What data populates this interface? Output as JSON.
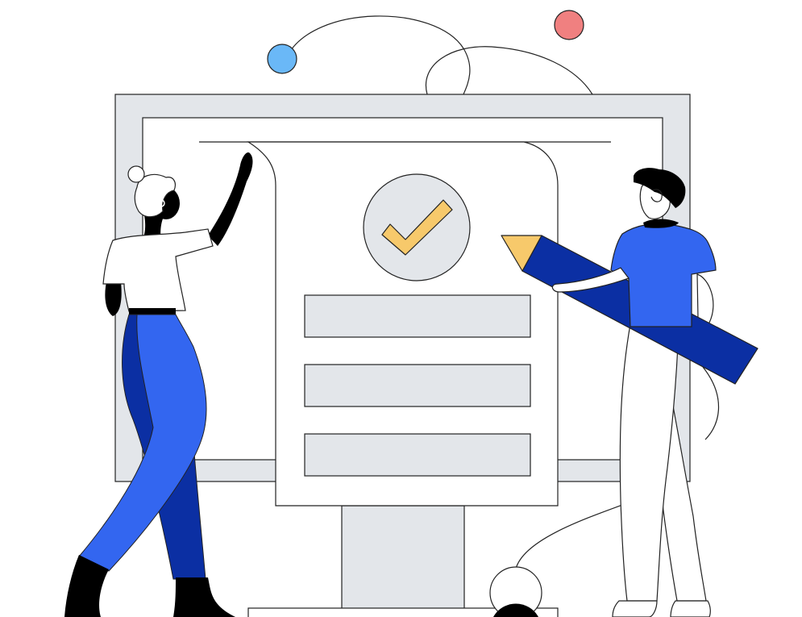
{
  "scene": {
    "subject": "illustration",
    "colors": {
      "outline": "#222222",
      "panel_gray": "#e3e6ea",
      "white": "#ffffff",
      "check_yellow": "#f7c96b",
      "accent_blue": "#3366f0",
      "deep_blue": "#0b2fa3",
      "dot_blue": "#6ab8f7",
      "dot_red": "#f08080",
      "skin_dark": "#000000"
    },
    "document": {
      "check_icon": "checkmark-icon",
      "field_count": 3
    }
  }
}
